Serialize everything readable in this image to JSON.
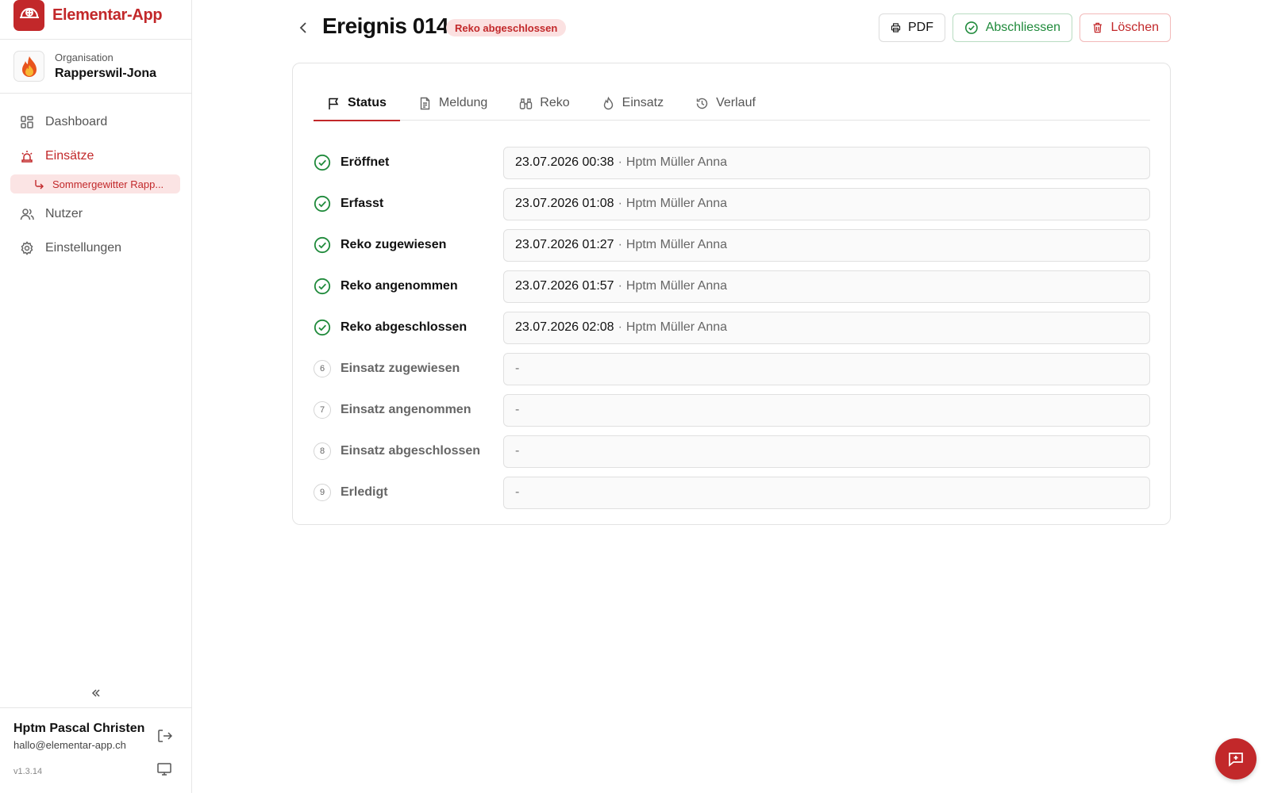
{
  "app": {
    "name": "Elementar-App"
  },
  "organization": {
    "label": "Organisation",
    "name": "Rapperswil-Jona"
  },
  "sidebar": {
    "items": [
      {
        "label": "Dashboard",
        "icon": "dashboard-icon",
        "active": false
      },
      {
        "label": "Einsätze",
        "icon": "siren-icon",
        "active": true
      },
      {
        "label": "Nutzer",
        "icon": "users-icon",
        "active": false
      },
      {
        "label": "Einstellungen",
        "icon": "gear-icon",
        "active": false
      }
    ],
    "sub_item": {
      "label": "Sommergewitter Rapp..."
    }
  },
  "user": {
    "name": "Hptm Pascal Christen",
    "email": "hallo@elementar-app.ch",
    "version": "v1.3.14"
  },
  "header": {
    "title": "Ereignis 014",
    "badge": "Reko abgeschlossen",
    "buttons": {
      "pdf": "PDF",
      "close": "Abschliessen",
      "delete": "Löschen"
    }
  },
  "tabs": [
    {
      "label": "Status",
      "icon": "flag-icon",
      "active": true
    },
    {
      "label": "Meldung",
      "icon": "document-icon",
      "active": false
    },
    {
      "label": "Reko",
      "icon": "binoculars-icon",
      "active": false
    },
    {
      "label": "Einsatz",
      "icon": "flame-icon",
      "active": false
    },
    {
      "label": "Verlauf",
      "icon": "history-icon",
      "active": false
    }
  ],
  "steps": [
    {
      "label": "Eröffnet",
      "done": true,
      "date": "23.07.2026 00:38",
      "sep": "·",
      "user": "Hptm Müller Anna"
    },
    {
      "label": "Erfasst",
      "done": true,
      "date": "23.07.2026 01:08",
      "sep": "·",
      "user": "Hptm Müller Anna"
    },
    {
      "label": "Reko zugewiesen",
      "done": true,
      "date": "23.07.2026 01:27",
      "sep": "·",
      "user": "Hptm Müller Anna"
    },
    {
      "label": "Reko angenommen",
      "done": true,
      "date": "23.07.2026 01:57",
      "sep": "·",
      "user": "Hptm Müller Anna"
    },
    {
      "label": "Reko abgeschlossen",
      "done": true,
      "date": "23.07.2026 02:08",
      "sep": "·",
      "user": "Hptm Müller Anna"
    },
    {
      "label": "Einsatz zugewiesen",
      "done": false,
      "number": "6",
      "value": "-"
    },
    {
      "label": "Einsatz angenommen",
      "done": false,
      "number": "7",
      "value": "-"
    },
    {
      "label": "Einsatz abgeschlossen",
      "done": false,
      "number": "8",
      "value": "-"
    },
    {
      "label": "Erledigt",
      "done": false,
      "number": "9",
      "value": "-"
    }
  ],
  "colors": {
    "brand": "#c2282a",
    "success": "#1f8a3b",
    "badge_bg": "#fbe1e1"
  }
}
